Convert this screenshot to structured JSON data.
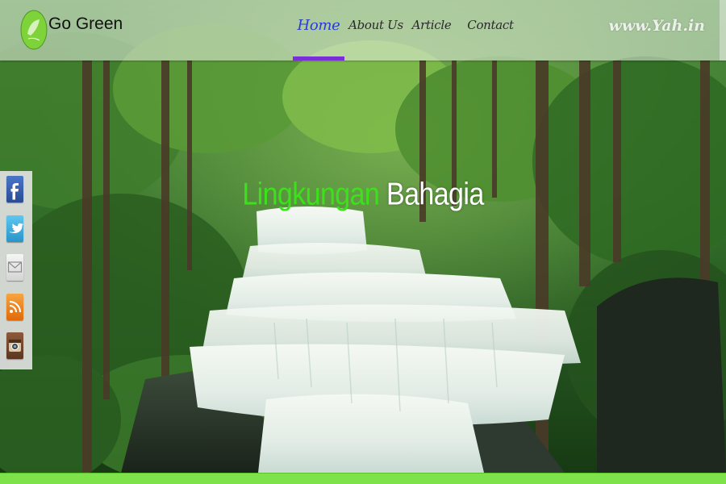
{
  "header": {
    "brand": "Go Green",
    "logo_text": "Go Green",
    "site_url": "www.Yah.in",
    "nav": [
      {
        "label": "Home",
        "active": true
      },
      {
        "label": "About Us",
        "active": false
      },
      {
        "label": "Article",
        "active": false
      },
      {
        "label": "Contact",
        "active": false
      }
    ]
  },
  "hero": {
    "headline_green": "Lingkungan",
    "headline_white": "Bahagia",
    "accent_green": "#3be21b"
  },
  "social": [
    {
      "icon": "facebook-icon"
    },
    {
      "icon": "twitter-icon"
    },
    {
      "icon": "email-icon"
    },
    {
      "icon": "rss-icon"
    },
    {
      "icon": "instagram-icon"
    }
  ],
  "colors": {
    "nav_active_text": "#2b3bd6",
    "nav_active_underline": "#7a2fd6",
    "bottom_bar": "#7ee24a"
  }
}
